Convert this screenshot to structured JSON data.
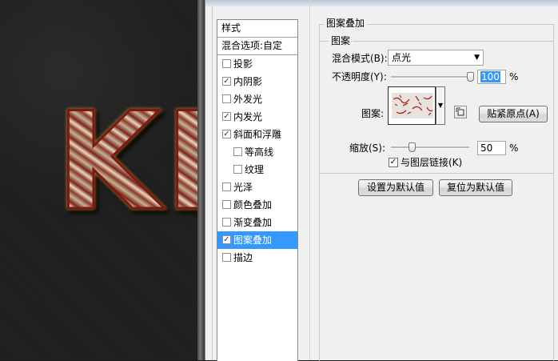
{
  "canvas": {
    "text": "KE"
  },
  "style_list": {
    "header": "样式",
    "blend_options": "混合选项:自定",
    "items": [
      {
        "label": "投影",
        "checked": false,
        "sub": false,
        "selected": false
      },
      {
        "label": "内阴影",
        "checked": true,
        "sub": false,
        "selected": false
      },
      {
        "label": "外发光",
        "checked": false,
        "sub": false,
        "selected": false
      },
      {
        "label": "内发光",
        "checked": true,
        "sub": false,
        "selected": false
      },
      {
        "label": "斜面和浮雕",
        "checked": true,
        "sub": false,
        "selected": false
      },
      {
        "label": "等高线",
        "checked": false,
        "sub": true,
        "selected": false
      },
      {
        "label": "纹理",
        "checked": false,
        "sub": true,
        "selected": false
      },
      {
        "label": "光泽",
        "checked": false,
        "sub": false,
        "selected": false
      },
      {
        "label": "颜色叠加",
        "checked": false,
        "sub": false,
        "selected": false
      },
      {
        "label": "渐变叠加",
        "checked": false,
        "sub": false,
        "selected": false
      },
      {
        "label": "图案叠加",
        "checked": true,
        "sub": false,
        "selected": true
      },
      {
        "label": "描边",
        "checked": false,
        "sub": false,
        "selected": false
      }
    ]
  },
  "panel": {
    "title": "图案叠加",
    "group_title": "图案",
    "blend_mode_label": "混合模式(B):",
    "blend_mode_value": "点光",
    "opacity_label": "不透明度(Y):",
    "opacity_value": "100",
    "opacity_unit": "%",
    "opacity_level": 100,
    "pattern_label": "图案:",
    "snap_button": "贴紧原点(A)",
    "scale_label": "缩放(S):",
    "scale_value": "50",
    "scale_unit": "%",
    "scale_level": 0.25,
    "link_label": "与图层链接(K)",
    "link_checked": true,
    "set_default_button": "设置为默认值",
    "reset_default_button": "复位为默认值"
  },
  "colors": {
    "selection": "#3399ff",
    "dialog_bg": "#f0f0f0"
  }
}
